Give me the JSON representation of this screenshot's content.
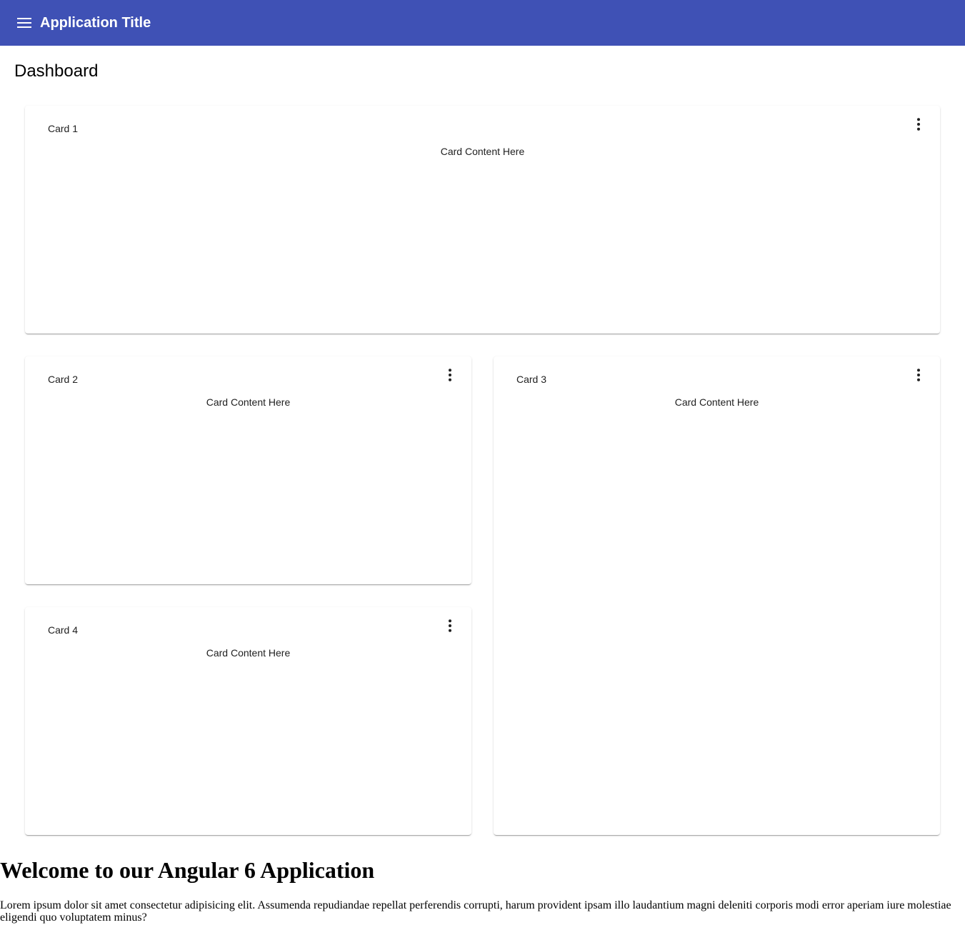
{
  "toolbar": {
    "title": "Application Title",
    "menu_icon": "menu-icon",
    "background_color": "#3f51b5"
  },
  "page": {
    "title": "Dashboard"
  },
  "cards": [
    {
      "title": "Card 1",
      "content": "Card Content Here",
      "menu_icon": "more-vert-icon"
    },
    {
      "title": "Card 2",
      "content": "Card Content Here",
      "menu_icon": "more-vert-icon"
    },
    {
      "title": "Card 3",
      "content": "Card Content Here",
      "menu_icon": "more-vert-icon"
    },
    {
      "title": "Card 4",
      "content": "Card Content Here",
      "menu_icon": "more-vert-icon"
    }
  ],
  "welcome": {
    "heading": "Welcome to our Angular 6 Application",
    "body": "Lorem ipsum dolor sit amet consectetur adipisicing elit. Assumenda repudiandae repellat perferendis corrupti, harum provident ipsam illo laudantium magni deleniti corporis modi error aperiam iure molestiae eligendi quo voluptatem minus?"
  }
}
